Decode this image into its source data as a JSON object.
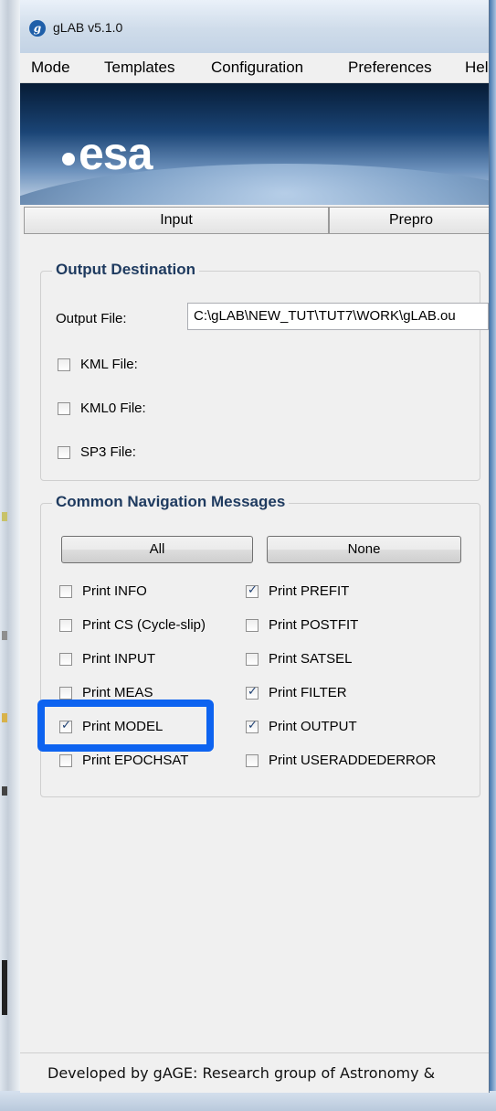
{
  "window": {
    "title": "gLAB v5.1.0",
    "app_icon_letter": "g"
  },
  "menu": [
    "Mode",
    "Templates",
    "Configuration",
    "Preferences",
    "Hel"
  ],
  "banner": {
    "logo_text": "esa"
  },
  "tabs": [
    {
      "label": "Input",
      "selected": true
    },
    {
      "label": "Prepro",
      "selected": false
    }
  ],
  "output_destination": {
    "title": "Output Destination",
    "output_file_label": "Output File:",
    "output_file_value": "C:\\gLAB\\NEW_TUT\\TUT7\\WORK\\gLAB.ou",
    "options": [
      {
        "label": "KML File:",
        "checked": false
      },
      {
        "label": "KML0 File:",
        "checked": false
      },
      {
        "label": "SP3 File:",
        "checked": false
      }
    ]
  },
  "navigation_messages": {
    "title": "Common Navigation Messages",
    "all_button": "All",
    "none_button": "None",
    "left_column": [
      {
        "label": "Print INFO",
        "checked": false
      },
      {
        "label": "Print CS (Cycle-slip)",
        "checked": false
      },
      {
        "label": "Print INPUT",
        "checked": false
      },
      {
        "label": "Print MEAS",
        "checked": false
      },
      {
        "label": "Print MODEL",
        "checked": true
      },
      {
        "label": "Print EPOCHSAT",
        "checked": false
      }
    ],
    "right_column": [
      {
        "label": "Print PREFIT",
        "checked": true
      },
      {
        "label": "Print POSTFIT",
        "checked": false
      },
      {
        "label": "Print SATSEL",
        "checked": false
      },
      {
        "label": "Print FILTER",
        "checked": true
      },
      {
        "label": "Print OUTPUT",
        "checked": true
      },
      {
        "label": "Print USERADDEDERROR",
        "checked": false
      }
    ]
  },
  "footer": {
    "text": "Developed by gAGE: Research group of Astronomy &"
  },
  "colors": {
    "highlight": "#0d63f0",
    "group_title": "#1e3a5f"
  }
}
